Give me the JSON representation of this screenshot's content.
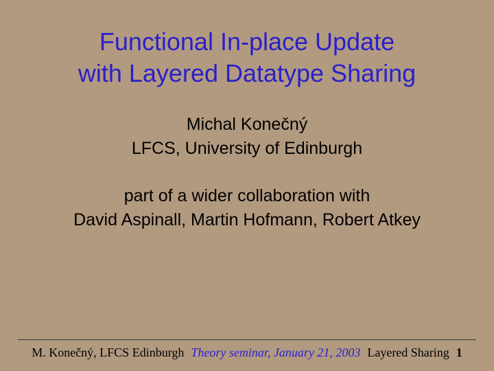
{
  "slide": {
    "title_line1": "Functional In-place Update",
    "title_line2": "with Layered Datatype Sharing",
    "author": "Michal Konečný",
    "affiliation": "LFCS, University of Edinburgh",
    "collab_intro": "part of a wider collaboration with",
    "collab_names": "David Aspinall, Martin Hofmann, Robert Atkey"
  },
  "footer": {
    "author_short": "M. Konečný, LFCS Edinburgh",
    "event": "Theory seminar, January 21, 2003",
    "topic": "Layered Sharing",
    "page": "1"
  }
}
